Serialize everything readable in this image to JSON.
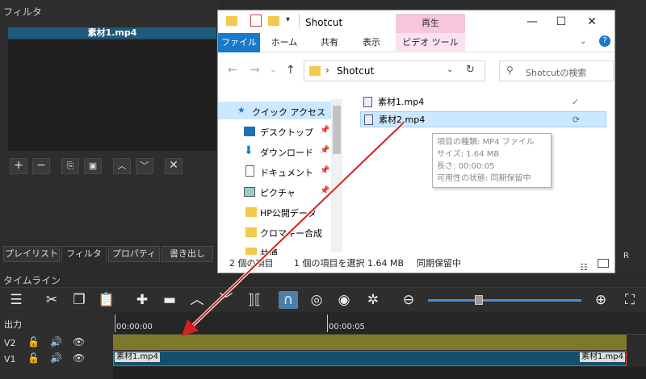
{
  "filters_panel": {
    "title": "フィルタ",
    "clip_name": "素材1.mp4",
    "buttons": [
      "+",
      "−",
      "copy",
      "paste",
      "up",
      "down",
      "close"
    ]
  },
  "bottom_tabs": [
    "プレイリスト",
    "フィルタ",
    "プロパティ",
    "書き出し"
  ],
  "timeline": {
    "title": "タイムライン",
    "output_label": "出力",
    "tracks": [
      {
        "name": "V2"
      },
      {
        "name": "V1"
      }
    ],
    "ruler": [
      "00:00:00",
      "00:00:05"
    ],
    "clip_start_label": "素材1.mp4",
    "clip_end_label": "素材1.mp4"
  },
  "explorer": {
    "title": "Shotcut",
    "context_tab": "再生",
    "ribbon_tabs": [
      "ファイル",
      "ホーム",
      "共有",
      "表示",
      "ビデオ ツール"
    ],
    "address": "Shotcut",
    "search_placeholder": "Shotcutの検索",
    "nav_items": [
      {
        "label": "クイック アクセス",
        "icon": "star-icon"
      },
      {
        "label": "デスクトップ",
        "icon": "desktop-icon",
        "pinned": true
      },
      {
        "label": "ダウンロード",
        "icon": "download-icon",
        "pinned": true
      },
      {
        "label": "ドキュメント",
        "icon": "document-icon",
        "pinned": true
      },
      {
        "label": "ピクチャ",
        "icon": "picture-icon",
        "pinned": true
      },
      {
        "label": "HP公開データ",
        "icon": "folder-icon"
      },
      {
        "label": "クロマキー合成",
        "icon": "folder-icon"
      },
      {
        "label": "共通",
        "icon": "folder-icon"
      }
    ],
    "files": [
      {
        "name": "素材1.mp4",
        "status": "synced"
      },
      {
        "name": "素材2.mp4",
        "status": "syncing"
      }
    ],
    "tooltip": {
      "line1": "項目の種類: MP4 ファイル",
      "line2": "サイズ: 1.64 MB",
      "line3": "長さ: 00:00:05",
      "line4": "可用性の状態: 同期保留中"
    },
    "status": {
      "count": "2 個の項目",
      "selected": "1 個の項目を選択 1.64 MB",
      "sync": "同期保留中"
    }
  },
  "right_strip_label": "R",
  "colors": {
    "accent": "#1979ca",
    "arrow": "#d42020",
    "v2": "#7a7a2a",
    "v1": "#14506b"
  }
}
